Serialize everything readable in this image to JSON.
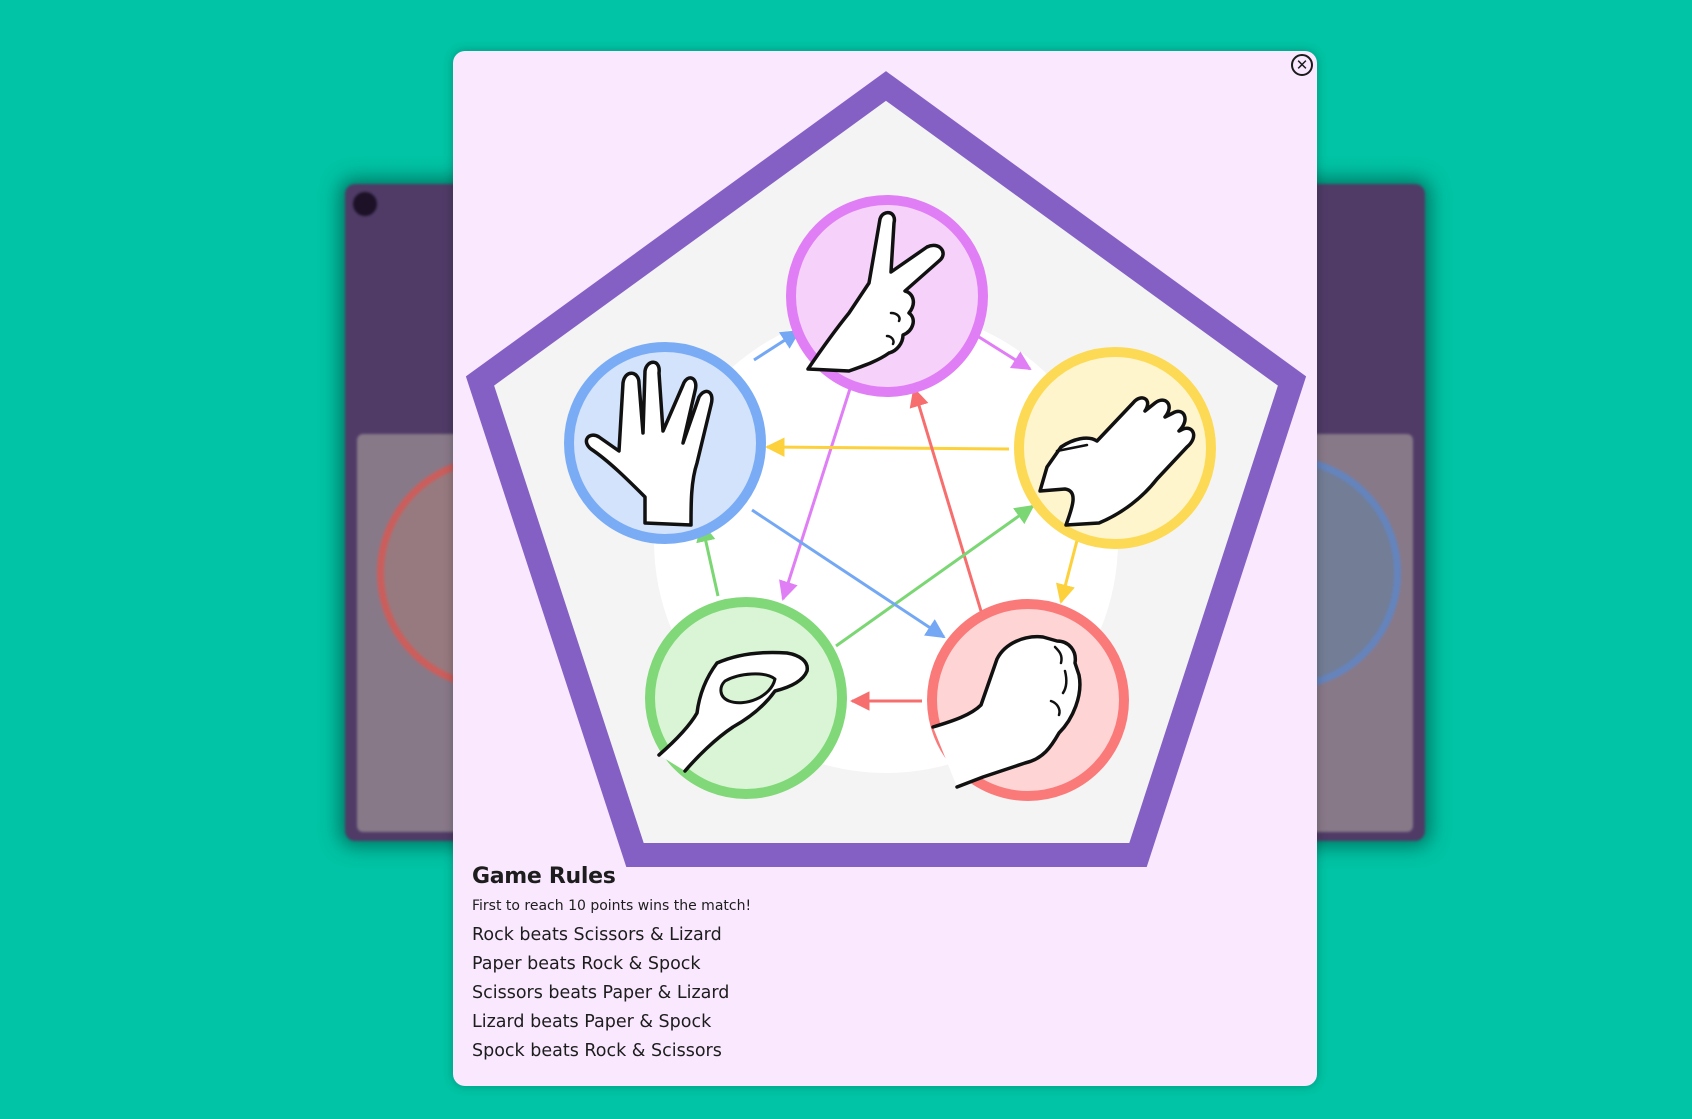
{
  "modal": {
    "close_icon": "close-icon",
    "close_glyph": "✕"
  },
  "diagram": {
    "items": [
      {
        "name": "scissors",
        "icon": "scissors-hand-icon",
        "color": "#e07ef5",
        "fill": "#f6d2fb"
      },
      {
        "name": "paper",
        "icon": "paper-hand-icon",
        "color": "#fdda55",
        "fill": "#fff5cc"
      },
      {
        "name": "rock",
        "icon": "rock-hand-icon",
        "color": "#fa7a7a",
        "fill": "#ffd4d4"
      },
      {
        "name": "lizard",
        "icon": "lizard-hand-icon",
        "color": "#80d879",
        "fill": "#d9f5d5"
      },
      {
        "name": "spock",
        "icon": "spock-hand-icon",
        "color": "#7aacf5",
        "fill": "#d3e3fc"
      }
    ],
    "pentagon_color": "#8560c4"
  },
  "rules": {
    "title": "Game Rules",
    "subtitle": "First to reach 10 points wins the match!",
    "lines": [
      "Rock beats Scissors & Lizard",
      "Paper beats Rock & Spock",
      "Scissors beats Paper & Lizard",
      "Lizard beats Paper & Spock",
      "Spock beats Rock & Scissors"
    ]
  }
}
